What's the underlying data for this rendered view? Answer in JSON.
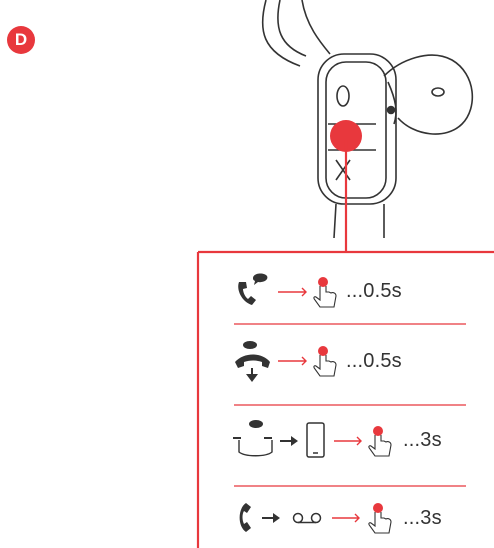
{
  "badge": "D",
  "accent_color": "#e8383d",
  "line_color": "#333333",
  "instructions": [
    {
      "id": "answer-call",
      "icons": [
        "phone-incoming-icon",
        "arrow-right-icon",
        "press-button-icon"
      ],
      "duration": "...0.5s"
    },
    {
      "id": "end-call",
      "icons": [
        "phone-hangup-icon",
        "arrow-right-icon",
        "press-button-icon"
      ],
      "duration": "...0.5s"
    },
    {
      "id": "switch-to-phone",
      "icons": [
        "headset-call-icon",
        "arrow-solid-icon",
        "smartphone-icon",
        "arrow-right-icon",
        "press-button-icon"
      ],
      "duration": "...3s"
    },
    {
      "id": "voicemail",
      "icons": [
        "phone-icon",
        "arrow-solid-icon",
        "voicemail-icon",
        "arrow-right-icon",
        "press-button-icon"
      ],
      "duration": "...3s"
    }
  ]
}
